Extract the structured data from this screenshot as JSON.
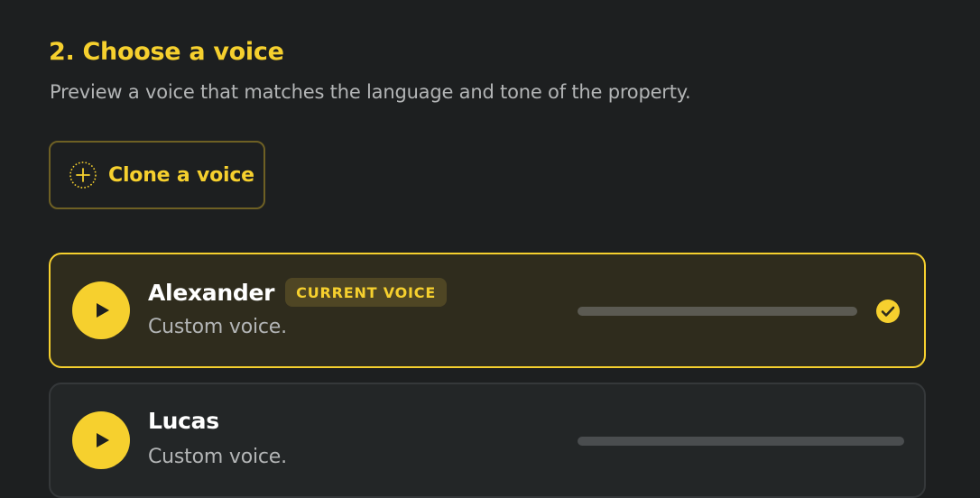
{
  "section": {
    "title": "2. Choose a voice",
    "subtitle": "Preview a voice that matches the language and tone of the property."
  },
  "clone_button": {
    "label": "Clone a voice",
    "icon": "plus-circle-icon"
  },
  "voices": [
    {
      "name": "Alexander",
      "badge": "CURRENT VOICE",
      "description": "Custom voice.",
      "selected": true,
      "progress": 0,
      "status_icon": "check-circle-icon"
    },
    {
      "name": "Lucas",
      "description": "Custom voice.",
      "selected": false,
      "progress": 0
    }
  ],
  "colors": {
    "background": "#1d1f20",
    "accent": "#f6d02e",
    "selected_card_bg": "#2f2c1d",
    "card_bg": "#232627",
    "muted_text": "#b3b5b6"
  }
}
